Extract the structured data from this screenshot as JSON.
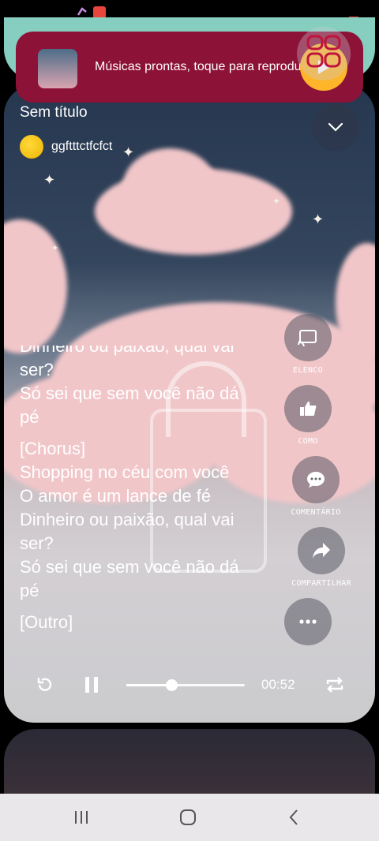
{
  "player": {
    "title": "Sem título",
    "author": "ggftttctfcfct"
  },
  "notification": {
    "text": "Músicas prontas, toque para reproduzir"
  },
  "lyrics": [
    "Dinheiro ou paixão, qual vai",
    "ser?",
    "Só sei que sem você não dá",
    "pé",
    "",
    "[Chorus]",
    "Shopping no céu com você",
    "O amor é um lance de fé",
    "Dinheiro ou paixão, qual vai",
    "ser?",
    "Só sei que sem você não dá",
    "pé",
    "",
    "[Outro]"
  ],
  "actions": {
    "cast": "ELENCO",
    "like": "COMO",
    "comment": "COMENTÁRIO",
    "share": "COMPARTILHAR"
  },
  "playback": {
    "time": "00:52",
    "progress": 0.38
  },
  "icons": {
    "collapse": "chevron-down-icon",
    "cast": "cast-icon",
    "like": "thumbs-up-icon",
    "comment": "comment-icon",
    "share": "share-icon",
    "more": "more-icon",
    "replay": "replay-icon",
    "pause": "pause-icon",
    "repeat": "repeat-icon"
  },
  "colors": {
    "notification_bg": "#8d1238",
    "play_accent": "#ffb52a"
  }
}
